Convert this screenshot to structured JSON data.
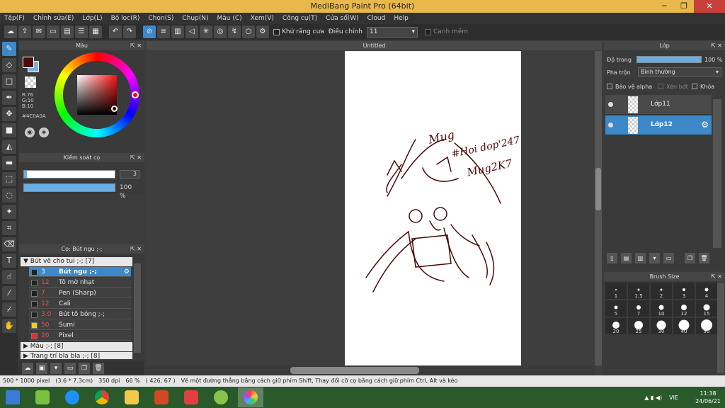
{
  "window": {
    "title": "MediBang Paint Pro (64bit)",
    "minimize": "─",
    "maximize": "❐",
    "close": "✕"
  },
  "menu": [
    "Tệp(F)",
    "Chỉnh sửa(E)",
    "Lớp(L)",
    "Bộ lọc(R)",
    "Chọn(S)",
    "Chụp(N)",
    "Màu (C)",
    "Xem(V)",
    "Công cụ(T)",
    "Cửa sổ(W)",
    "Cloud",
    "Help"
  ],
  "toolbar": {
    "antialias_label": "Khử răng cưa",
    "adjust_label": "Điều chỉnh",
    "adjust_value": "11",
    "canh_mem_label": "Canh mềm"
  },
  "color_panel": {
    "title": "Màu",
    "r": "R:76",
    "g": "G:10",
    "b": "B:10",
    "hex": "#4C0A0A",
    "fg": "#4c0a0a"
  },
  "brush_control": {
    "title": "Kiểm soát cọ",
    "size_value": "3",
    "opacity_value": "100 %",
    "size_fraction": 0.03,
    "opacity_fraction": 1.0
  },
  "brushes": {
    "title": "Cọ: Bút ngu ;-;",
    "group1": "▼ Bút vẽ cho tui ;-; [7]",
    "items": [
      {
        "size": "3",
        "name": "Bút ngu ;-;",
        "color": "#222222",
        "selected": true
      },
      {
        "size": "12",
        "name": "Tô mờ nhạt",
        "color": "#222222"
      },
      {
        "size": "7",
        "name": "Pen (Sharp)",
        "color": "#222222"
      },
      {
        "size": "12",
        "name": "Cali",
        "color": "#222222"
      },
      {
        "size": "3.0",
        "name": "Bút tô bóng ;-;",
        "color": "#222222"
      },
      {
        "size": "50",
        "name": "Sumi",
        "color": "#f0d000"
      },
      {
        "size": "20",
        "name": "Pixel",
        "color": "#e03030"
      }
    ],
    "group2": "▶ Màu ;-; [8]",
    "group3": "▶ Trang trí bla bla ;-; [8]"
  },
  "canvas": {
    "tab": "Untitled"
  },
  "layer_panel": {
    "title": "Lớp",
    "opacity_label": "Độ trong",
    "opacity_value": "100 %",
    "blend_label": "Pha trộn",
    "blend_value": "Bình thường",
    "alpha_label": "Bảo vệ alpha",
    "clip_label": "Xén bớt",
    "lock_label": "Khóa",
    "layers": [
      {
        "name": "Lớp11",
        "selected": false
      },
      {
        "name": "Lớp12",
        "selected": true
      }
    ]
  },
  "brush_size": {
    "title": "Brush Size",
    "sizes": [
      "1",
      "1.5",
      "2",
      "3",
      "4",
      "5",
      "7",
      "10",
      "12",
      "15",
      "20",
      "25",
      "30",
      "40",
      "50"
    ]
  },
  "status": {
    "dimensions": "500 * 1000 pixel",
    "cm": "(3.6 * 7.3cm)",
    "dpi": "350 dpi",
    "zoom": "66 %",
    "coords": "( 426, 67 )",
    "hint": "Vẽ một đường thẳng bằng cách giữ phím Shift, Thay đổi cỡ cọ bằng cách giữ phím Ctrl, Alt và kéo"
  },
  "taskbar": {
    "lang": "VIE",
    "time": "11:38",
    "date": "24/06/21"
  },
  "signature": {
    "line1": "Mug",
    "line2": "#Hoi dop'247",
    "line3": "Mug2K7"
  }
}
